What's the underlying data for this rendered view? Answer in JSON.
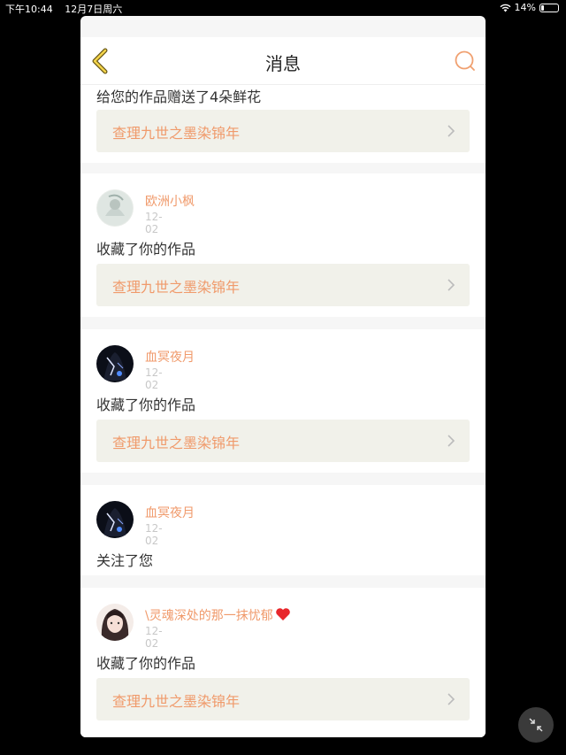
{
  "status_bar": {
    "time": "下午10:44",
    "date": "12月7日周六",
    "battery": "14%",
    "battery_level": 0.14
  },
  "nav": {
    "title": "消息",
    "back_icon": "chevron-left-icon",
    "search_icon": "search-icon"
  },
  "messages": [
    {
      "action": "给您的作品赠送了4朵鲜花",
      "work": "查理九世之墨染锦年"
    },
    {
      "user": "欧洲小枫",
      "date": "12-02",
      "action": "收藏了你的作品",
      "work": "查理九世之墨染锦年"
    },
    {
      "user": "血冥夜月",
      "date": "12-02",
      "action": "收藏了你的作品",
      "work": "查理九世之墨染锦年"
    },
    {
      "user": "血冥夜月",
      "date": "12-02",
      "action": "关注了您"
    },
    {
      "user": "\\灵魂深处的那一抹忧郁",
      "date": "12-02",
      "action": "收藏了你的作品",
      "work": "查理九世之墨染锦年"
    }
  ],
  "colors": {
    "accent": "#f09a6b",
    "card_link_bg": "#f1f1ea",
    "heart": "#e8262b"
  }
}
